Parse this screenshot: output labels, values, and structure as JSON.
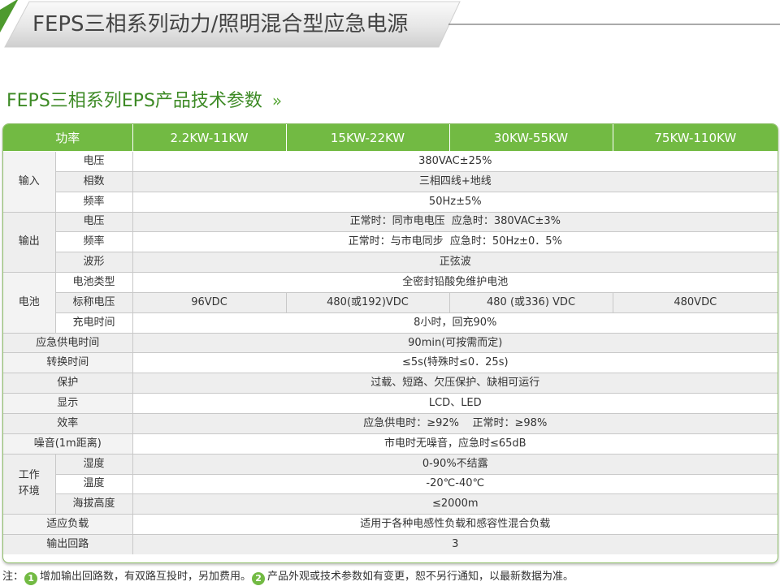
{
  "header": {
    "title": "FEPS三相系列动力/照明混合型应急电源"
  },
  "section": {
    "title": "FEPS三相系列EPS产品技术参数",
    "chevron": "»"
  },
  "table": {
    "headers": [
      "功率",
      "2.2KW-11KW",
      "15KW-22KW",
      "30KW-55KW",
      "75KW-110KW"
    ],
    "groups": {
      "input": "输入",
      "output": "输出",
      "battery": "电池",
      "env": "工作环境"
    },
    "rows": {
      "in_voltage": {
        "label": "电压",
        "value": "380VAC±25%"
      },
      "in_phase": {
        "label": "相数",
        "value": "三相四线+地线"
      },
      "in_freq": {
        "label": "频率",
        "value": "50Hz±5%"
      },
      "out_voltage": {
        "label": "电压",
        "value": "正常时：同市电电压  应急时：380VAC±3%"
      },
      "out_freq": {
        "label": "频率",
        "value": "正常时：与市电同步  应急时：50Hz±0．5%"
      },
      "out_wave": {
        "label": "波形",
        "value": "正弦波"
      },
      "bat_type": {
        "label": "电池类型",
        "value": "全密封铅酸免维护电池"
      },
      "bat_voltage": {
        "label": "标称电压",
        "values": [
          "96VDC",
          "480(或192)VDC",
          "480 (或336) VDC",
          "480VDC"
        ]
      },
      "bat_charge": {
        "label": "充电时间",
        "value": "8小时，回充90%"
      },
      "backup_time": {
        "label": "应急供电时间",
        "value": "90min(可按需而定)"
      },
      "switch_time": {
        "label": "转换时间",
        "value": "≤5s(特殊时≤0．25s)"
      },
      "protection": {
        "label": "保护",
        "value": "过载、短路、欠压保护、缺相可运行"
      },
      "display": {
        "label": "显示",
        "value": "LCD、LED"
      },
      "efficiency": {
        "label": "效率",
        "value": "应急供电时：≥92%    正常时：≥98%"
      },
      "noise": {
        "label": "噪音(1m距离)",
        "value": "市电时无噪音，应急时≤65dB"
      },
      "env_humidity": {
        "label": "湿度",
        "value": "0-90%不结露"
      },
      "env_temp": {
        "label": "温度",
        "value": "-20℃-40℃"
      },
      "env_altitude": {
        "label": "海拔高度",
        "value": "≤2000m"
      },
      "load": {
        "label": "适应负载",
        "value": "适用于各种电感性负载和感容性混合负载"
      },
      "circuits": {
        "label": "输出回路",
        "value": "3"
      }
    }
  },
  "footnote": {
    "prefix": "注：",
    "n1": "1",
    "text1": "增加输出回路数，有双路互投时，另加费用。",
    "n2": "2",
    "text2": "产品外观或技术参数如有变更，恕不另行通知，以最新数据为准。"
  },
  "colors": {
    "accent_green": "#72ba43",
    "title_green": "#3d8a25",
    "row_shade": "#eeeeee"
  }
}
